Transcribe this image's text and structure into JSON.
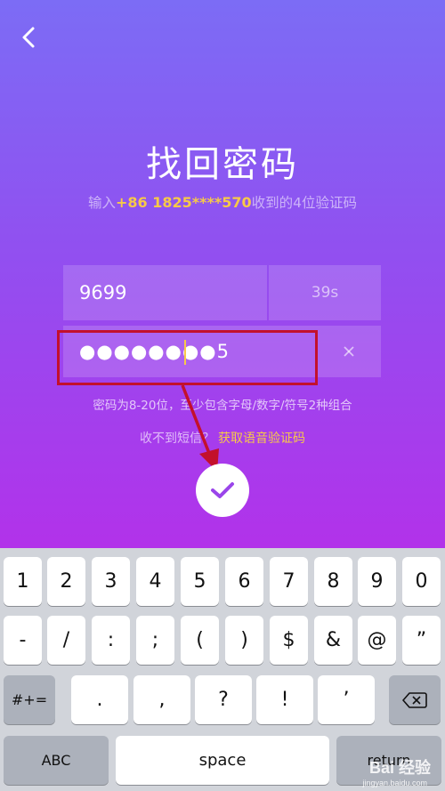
{
  "header": {
    "back_icon": "chevron-left-icon",
    "title": "找回密码",
    "subtitle_prefix": "输入",
    "phone": "+86 1825****570",
    "subtitle_suffix": "收到的4位验证码"
  },
  "form": {
    "code_value": "9699",
    "countdown": "39s",
    "password_masked": "●●●●●●●●5",
    "clear_icon": "close-icon",
    "password_hint": "密码为8-20位，至少包含字母/数字/符号2种组合",
    "no_sms_text": "收不到短信？",
    "voice_code_link": "获取语音验证码",
    "submit_icon": "checkmark-icon"
  },
  "annotation": {
    "highlight_color": "#c3102c"
  },
  "keyboard": {
    "row1": [
      "1",
      "2",
      "3",
      "4",
      "5",
      "6",
      "7",
      "8",
      "9",
      "0"
    ],
    "row2": [
      "-",
      "/",
      ":",
      ";",
      "(",
      ")",
      "$",
      "&",
      "@",
      "”"
    ],
    "row3_toggle": "#+=",
    "row3": [
      ".",
      ",",
      "?",
      "!",
      "’"
    ],
    "row3_backspace_icon": "backspace-icon",
    "abc_label": "ABC",
    "space_label": "space",
    "return_label": "return"
  },
  "watermark": {
    "brand": "Bai 经验",
    "url": "jingyan.baidu.com"
  },
  "colors": {
    "gradient_top": "#7c6cf5",
    "gradient_bottom": "#b232ea",
    "accent": "#f7c948"
  }
}
